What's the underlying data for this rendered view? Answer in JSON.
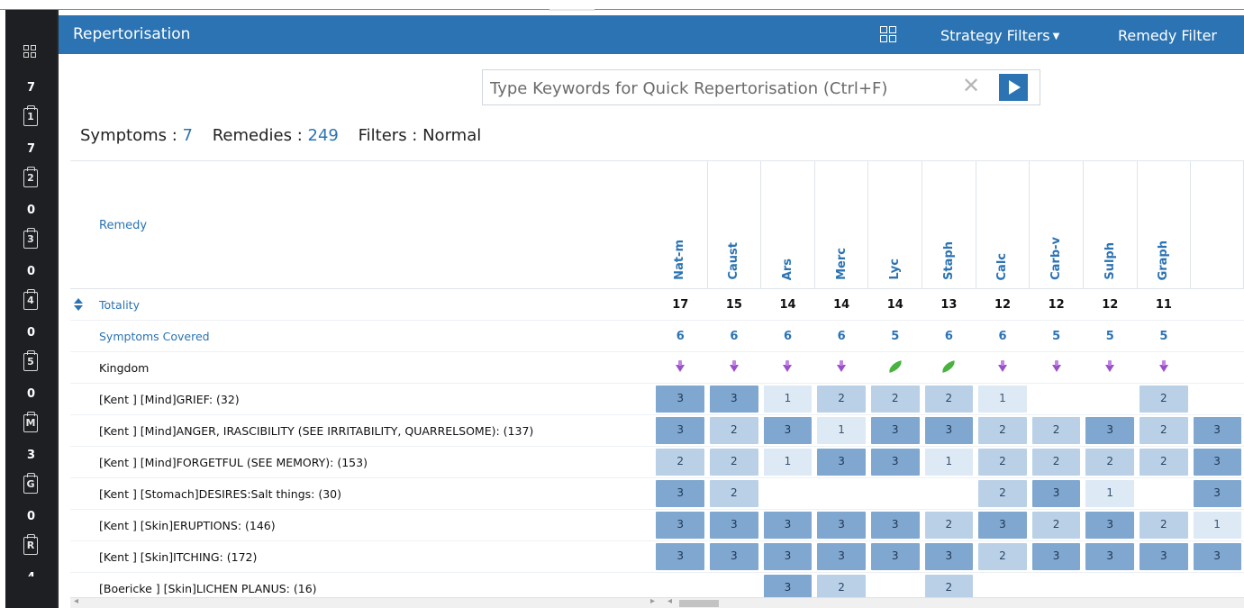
{
  "app": {
    "title": "Repertorisation",
    "menus": [
      {
        "label": "Strategy Filters"
      },
      {
        "label": "Remedy Filter"
      }
    ]
  },
  "search": {
    "placeholder": "Type Keywords for Quick Repertorisation (Ctrl+F)",
    "clear_glyph": "✕"
  },
  "stats": {
    "symptoms_label": "Symptoms :",
    "symptoms_value": "7",
    "remedies_label": "Remedies :",
    "remedies_value": "249",
    "filters_label": "Filters :",
    "filters_value": "Normal"
  },
  "rail": {
    "grid_icon": "grid-icon",
    "items": [
      {
        "count": "7"
      },
      {
        "clip": "1",
        "count": "7"
      },
      {
        "clip": "2",
        "count": "0"
      },
      {
        "clip": "3",
        "count": "0"
      },
      {
        "clip": "4",
        "count": "0"
      },
      {
        "clip": "5",
        "count": "0"
      },
      {
        "clip": "M",
        "count": "3"
      },
      {
        "clip": "G",
        "count": "0"
      },
      {
        "clip": "R",
        "count": "4"
      }
    ]
  },
  "table": {
    "remedy_header": "Remedy",
    "totality_label": "Totality",
    "covered_label": "Symptoms Covered",
    "kingdom_label": "Kingdom",
    "remedies": [
      "Nat-m",
      "Caust",
      "Ars",
      "Merc",
      "Lyc",
      "Staph",
      "Calc",
      "Carb-v",
      "Sulph",
      "Graph",
      ""
    ],
    "totality": [
      "17",
      "15",
      "14",
      "14",
      "14",
      "13",
      "12",
      "12",
      "12",
      "11",
      ""
    ],
    "covered": [
      "6",
      "6",
      "6",
      "6",
      "5",
      "6",
      "6",
      "5",
      "5",
      "5",
      ""
    ],
    "kingdom": [
      "mineral",
      "mineral",
      "mineral",
      "mineral",
      "plant",
      "plant",
      "mineral",
      "mineral",
      "mineral",
      "mineral",
      ""
    ],
    "rubrics": [
      {
        "name": "[Kent ] [Mind]GRIEF: (32)",
        "grades": [
          3,
          3,
          1,
          2,
          2,
          2,
          1,
          0,
          0,
          2,
          0
        ]
      },
      {
        "name": "[Kent ] [Mind]ANGER, IRASCIBILITY (SEE IRRITABILITY, QUARRELSOME): (137)",
        "grades": [
          3,
          2,
          3,
          1,
          3,
          3,
          2,
          2,
          3,
          2,
          3
        ]
      },
      {
        "name": "[Kent ] [Mind]FORGETFUL (SEE MEMORY): (153)",
        "grades": [
          2,
          2,
          1,
          3,
          3,
          1,
          2,
          2,
          2,
          2,
          3
        ]
      },
      {
        "name": "[Kent ] [Stomach]DESIRES:Salt things: (30)",
        "grades": [
          3,
          2,
          0,
          0,
          0,
          0,
          2,
          3,
          1,
          0,
          3
        ]
      },
      {
        "name": "[Kent ] [Skin]ERUPTIONS: (146)",
        "grades": [
          3,
          3,
          3,
          3,
          3,
          2,
          3,
          2,
          3,
          2,
          1
        ]
      },
      {
        "name": "[Kent ] [Skin]ITCHING: (172)",
        "grades": [
          3,
          3,
          3,
          3,
          3,
          3,
          2,
          3,
          3,
          3,
          3
        ]
      },
      {
        "name": "[Boericke ] [Skin]LICHEN PLANUS: (16)",
        "grades": [
          0,
          0,
          3,
          2,
          0,
          2,
          0,
          0,
          0,
          0,
          0
        ]
      }
    ]
  },
  "colors": {
    "header_bg": "#2b73b3",
    "grade3": "#7fa7cf",
    "grade2": "#b9d0e6",
    "grade1": "#dde9f4",
    "rail_bg": "#1d1f22"
  }
}
